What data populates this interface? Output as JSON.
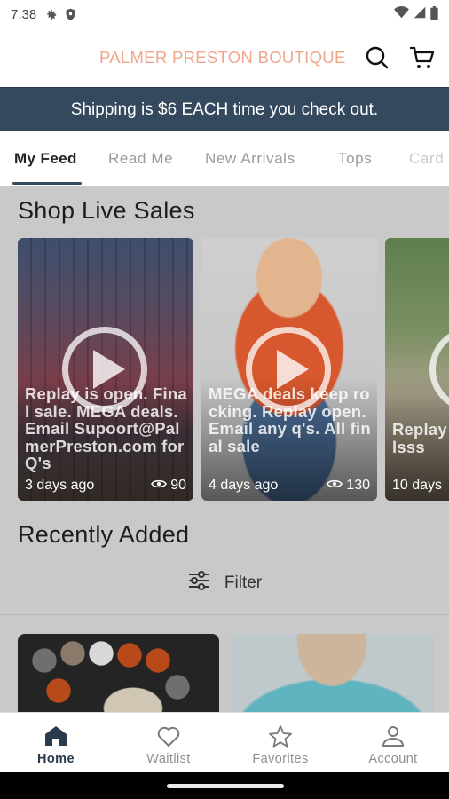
{
  "status_bar": {
    "time": "7:38"
  },
  "header": {
    "brand": "PALMER PRESTON BOUTIQUE",
    "brand_color": "#f0a68a"
  },
  "banner": {
    "text": "Shipping is $6 EACH time you check out.",
    "bg_color": "#35495e"
  },
  "tabs": [
    {
      "label": "My Feed",
      "active": true
    },
    {
      "label": "Read Me",
      "active": false
    },
    {
      "label": "New Arrivals",
      "active": false
    },
    {
      "label": "Tops",
      "active": false
    },
    {
      "label": "Card",
      "active": false
    }
  ],
  "live_sales": {
    "title": "Shop Live Sales",
    "cards": [
      {
        "text": "Replay is open. Final sale. MEGA deals. Email Supoort@PalmerPreston.com for Q's",
        "age": "3 days ago",
        "views": "90"
      },
      {
        "text": "MEGA deals keep rocking. Replay open. Email any q's. All final sale",
        "age": "4 days ago",
        "views": "130"
      },
      {
        "text": "Replay on deals dealsss",
        "age": "10 days"
      }
    ]
  },
  "recently_added": {
    "title": "Recently Added",
    "filter_label": "Filter"
  },
  "bottom_nav": [
    {
      "label": "Home",
      "icon": "home-icon",
      "active": true
    },
    {
      "label": "Waitlist",
      "icon": "heart-icon",
      "active": false
    },
    {
      "label": "Favorites",
      "icon": "star-icon",
      "active": false
    },
    {
      "label": "Account",
      "icon": "person-icon",
      "active": false
    }
  ]
}
